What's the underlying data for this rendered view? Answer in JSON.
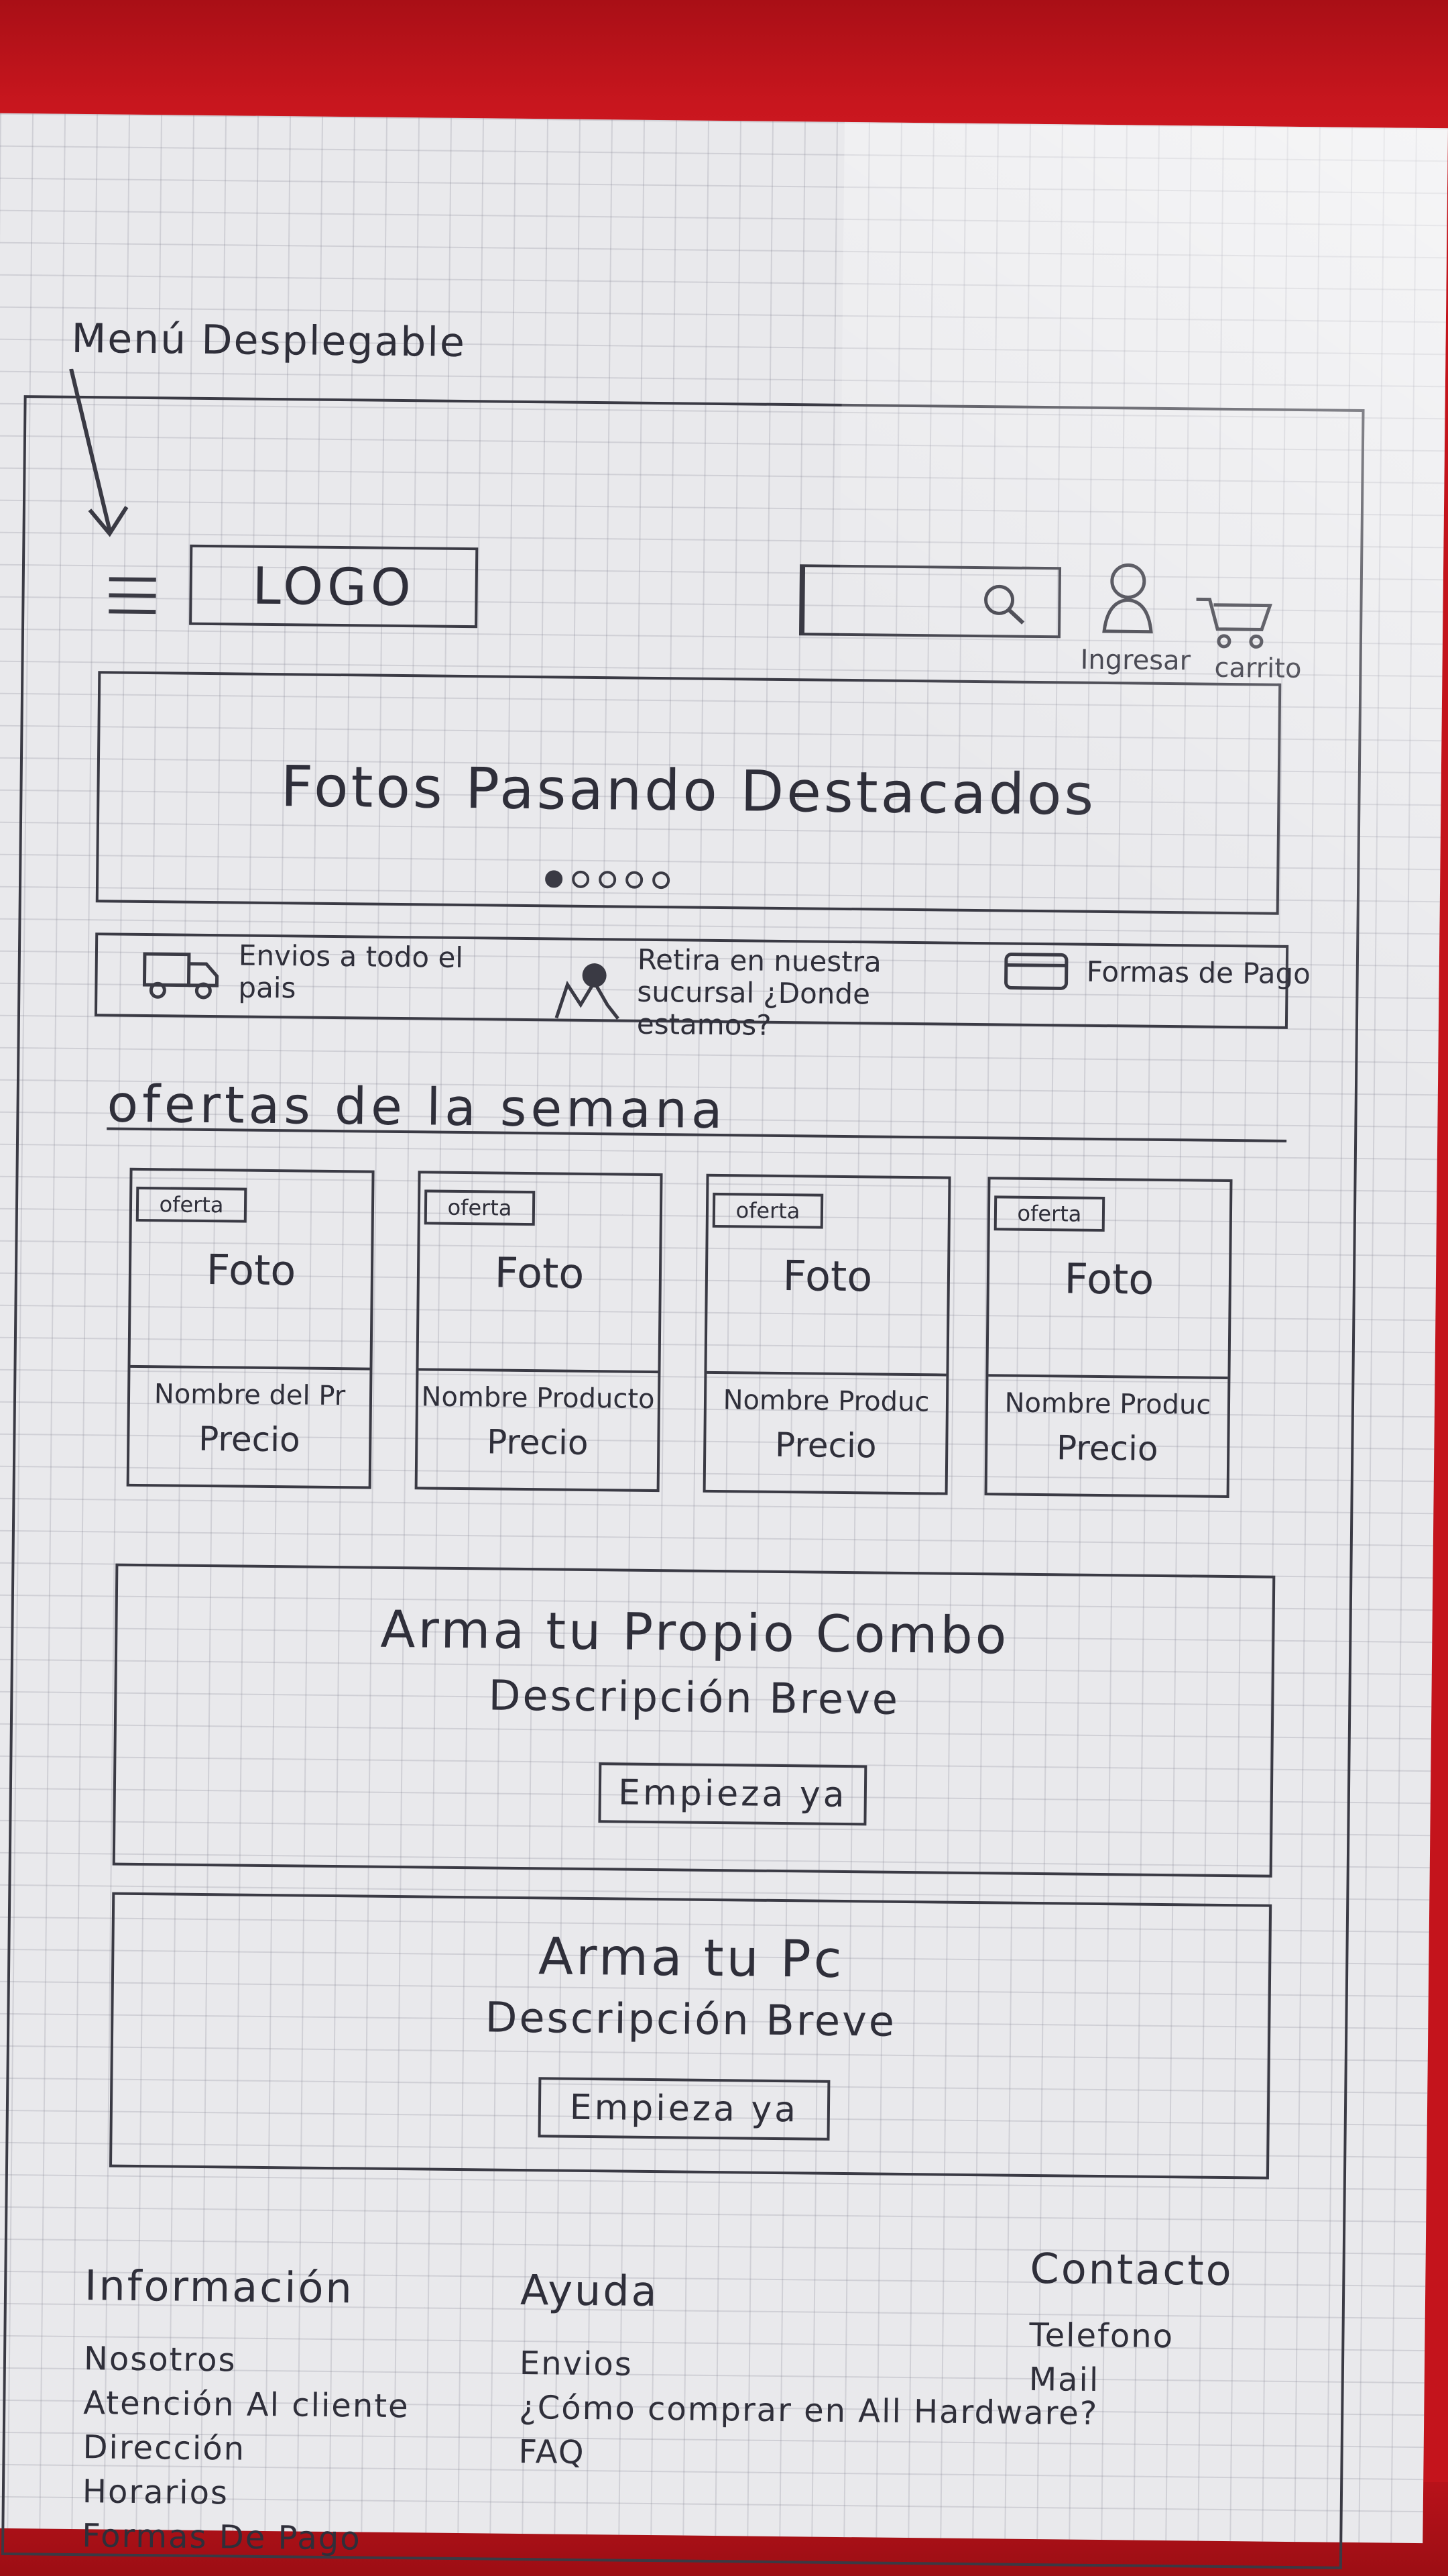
{
  "annotation": {
    "label": "Menú Desplegable"
  },
  "header": {
    "logo_text": "LOGO",
    "search_placeholder": "",
    "user_label": "Ingresar",
    "cart_label": "carrito"
  },
  "carousel": {
    "title": "Fotos Pasando Destacados",
    "dots": 5,
    "active_dot": 1
  },
  "benefits": [
    {
      "icon": "truck-icon",
      "text": "Envios a todo el pais"
    },
    {
      "icon": "location-pin-icon",
      "text": "Retira en nuestra sucursal ¿Donde estamos?"
    },
    {
      "icon": "credit-card-icon",
      "text": "Formas de Pago"
    }
  ],
  "offers": {
    "title": "ofertas de la semana",
    "cards": [
      {
        "badge": "oferta",
        "photo": "Foto",
        "name": "Nombre del Pr",
        "price": "Precio"
      },
      {
        "badge": "oferta",
        "photo": "Foto",
        "name": "Nombre Producto",
        "price": "Precio"
      },
      {
        "badge": "oferta",
        "photo": "Foto",
        "name": "Nombre Produc",
        "price": "Precio"
      },
      {
        "badge": "oferta",
        "photo": "Foto",
        "name": "Nombre Produc",
        "price": "Precio"
      }
    ]
  },
  "promos": [
    {
      "title": "Arma tu Propio Combo",
      "description": "Descripción Breve",
      "button": "Empieza ya"
    },
    {
      "title": "Arma tu Pc",
      "description": "Descripción Breve",
      "button": "Empieza ya"
    }
  ],
  "footer": {
    "info": {
      "title": "Información",
      "links": [
        "Nosotros",
        "Atención Al cliente",
        "Dirección",
        "Horarios",
        "Formas De Pago"
      ]
    },
    "help": {
      "title": "Ayuda",
      "links": [
        "Envios",
        "¿Cómo comprar en All Hardware?",
        "FAQ"
      ]
    },
    "contact": {
      "title": "Contacto",
      "links": [
        "Telefono",
        "Mail"
      ]
    }
  },
  "colors": {
    "ink": "#2f2f3a",
    "paper": "#e9e9ec",
    "background": "#c4141c"
  }
}
